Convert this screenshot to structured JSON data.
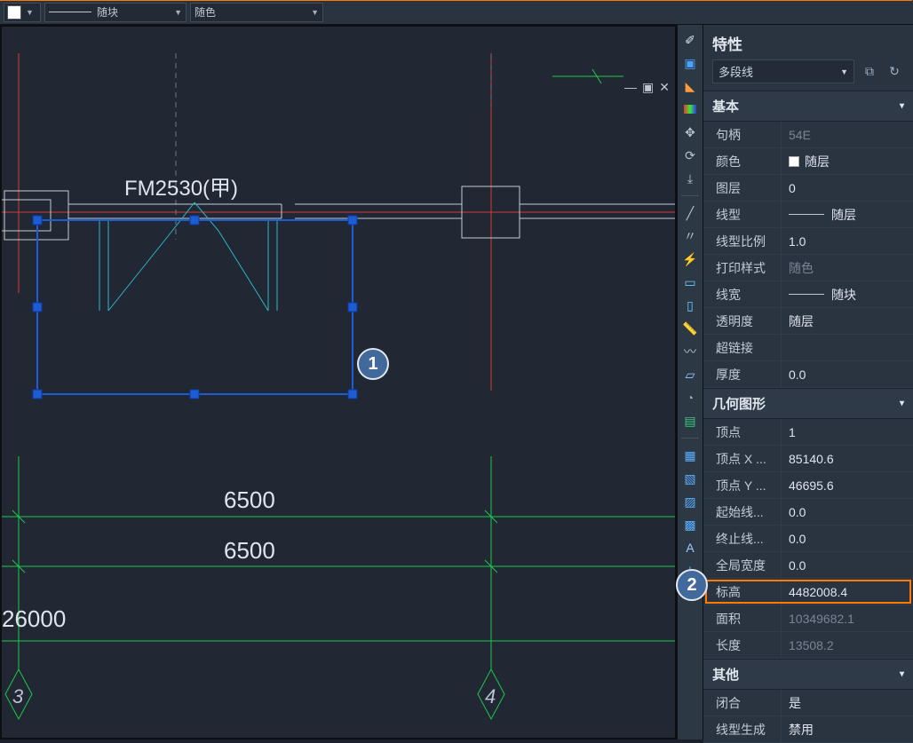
{
  "topbar": {
    "linetype_label": "随块",
    "color_label": "随色"
  },
  "canvas": {
    "label1": "FM2530(甲)",
    "dim1": "6500",
    "dim2": "6500",
    "dim3": "26000",
    "axis_a": "3",
    "axis_b": "4"
  },
  "bubbles": {
    "b1": "1",
    "b2": "2"
  },
  "panel": {
    "title": "特性",
    "object_type": "多段线",
    "sections": {
      "basic": "基本",
      "geometry": "几何图形",
      "other": "其他"
    },
    "props": {
      "handle_label": "句柄",
      "handle_val": "54E",
      "color_label": "颜色",
      "color_val": "随层",
      "layer_label": "图层",
      "layer_val": "0",
      "linetype_label": "线型",
      "linetype_val": "随层",
      "ltscale_label": "线型比例",
      "ltscale_val": "1.0",
      "plotstyle_label": "打印样式",
      "plotstyle_val": "随色",
      "lineweight_label": "线宽",
      "lineweight_val": "随块",
      "transparency_label": "透明度",
      "transparency_val": "随层",
      "hyperlink_label": "超链接",
      "hyperlink_val": "",
      "thickness_label": "厚度",
      "thickness_val": "0.0",
      "vertex_label": "顶点",
      "vertex_val": "1",
      "vx_label": "顶点 X ...",
      "vx_val": "85140.6",
      "vy_label": "顶点 Y ...",
      "vy_val": "46695.6",
      "startw_label": "起始线...",
      "startw_val": "0.0",
      "endw_label": "终止线...",
      "endw_val": "0.0",
      "globalw_label": "全局宽度",
      "globalw_val": "0.0",
      "elev_label": "标高",
      "elev_val": "4482008.4",
      "area_label": "面积",
      "area_val": "10349682.1",
      "length_label": "长度",
      "length_val": "13508.2",
      "closed_label": "闭合",
      "closed_val": "是",
      "ltgen_label": "线型生成",
      "ltgen_val": "禁用"
    }
  }
}
